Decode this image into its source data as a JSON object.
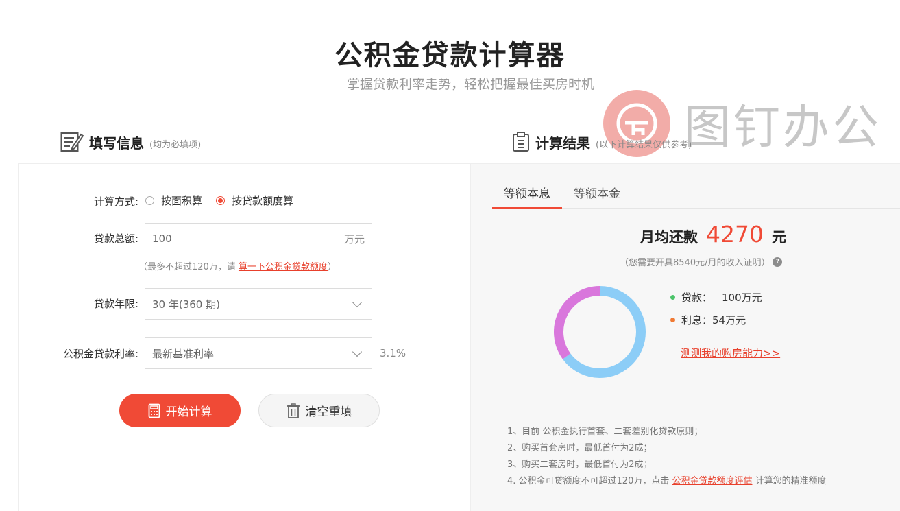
{
  "header": {
    "title": "公积金贷款计算器",
    "subtitle": "掌握贷款利率走势，轻松把握最佳买房时机"
  },
  "watermark": {
    "text": "图钉办公"
  },
  "left_section": {
    "title": "填写信息",
    "note": "(均为必填项)",
    "calc_method": {
      "label": "计算方式:",
      "options": [
        "按面积算",
        "按贷款额度算"
      ],
      "selected": "按贷款额度算"
    },
    "loan_total": {
      "label": "贷款总额:",
      "value": "100",
      "unit": "万元"
    },
    "hint": {
      "prefix": "（最多不超过120万，请 ",
      "link": "算一下公积金贷款额度",
      "suffix": "）"
    },
    "loan_term": {
      "label": "贷款年限:",
      "value": "30 年(360 期)"
    },
    "rate": {
      "label": "公积金贷款利率:",
      "value": "最新基准利率",
      "percent": "3.1%"
    },
    "buttons": {
      "calculate": "开始计算",
      "reset": "清空重填"
    }
  },
  "right_section": {
    "title": "计算结果",
    "note": "(以下计算结果仅供参考)",
    "tabs": [
      "等额本息",
      "等额本金"
    ],
    "active_tab": 0,
    "monthly": {
      "label": "月均还款",
      "value": "4270",
      "unit": "元"
    },
    "income_note": "（您需要开具8540元/月的收入证明）",
    "legend": {
      "principal_label": "贷款：",
      "principal_value": "100万元",
      "interest_label": "利息：",
      "interest_value": "54万元"
    },
    "test_link": "测测我的购房能力>>",
    "notes": {
      "line1": "1、目前 公积金执行首套、二套差别化贷款原则；",
      "line2": "2、购买首套房时，最低首付为2成；",
      "line3": "3、购买二套房时，最低首付为2成；",
      "line4_prefix": "4. 公积金可贷额度不可超过120万，点击 ",
      "line4_link": "公积金贷款额度评估",
      "line4_suffix": " 计算您的精准额度"
    }
  },
  "colors": {
    "accent": "#f04a36",
    "principal": "#8ccdf7",
    "interest": "#d977dc",
    "principal_dot": "#4cc46a",
    "interest_dot": "#f07a34"
  },
  "chart_data": {
    "type": "pie",
    "categories": [
      "贷款",
      "利息"
    ],
    "values": [
      100,
      54
    ]
  }
}
